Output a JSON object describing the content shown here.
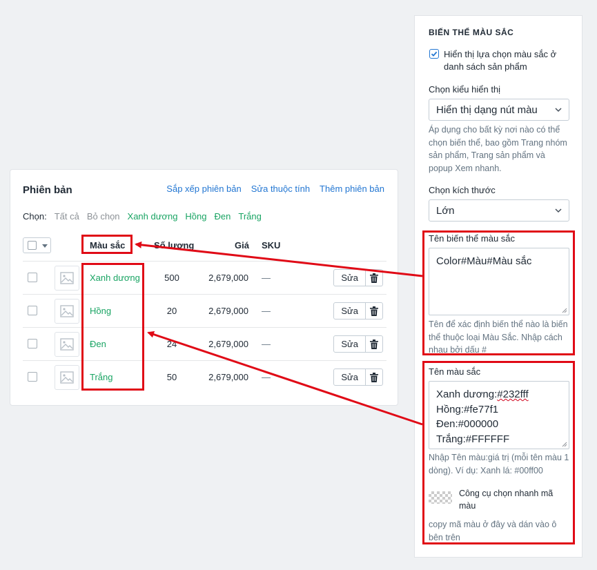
{
  "variants": {
    "title": "Phiên bản",
    "actions": [
      "Sắp xếp phiên bản",
      "Sửa thuộc tính",
      "Thêm phiên bản"
    ],
    "filter": {
      "label": "Chọn:",
      "select_all": "Tất cả",
      "deselect": "Bỏ chọn",
      "colors": [
        "Xanh dương",
        "Hồng",
        "Đen",
        "Trắng"
      ]
    },
    "columns": {
      "color": "Màu sắc",
      "qty": "Số lượng",
      "price": "Giá",
      "sku": "SKU"
    },
    "rows": [
      {
        "name": "Xanh dương",
        "qty": "500",
        "price": "2,679,000",
        "sku": "—",
        "edit": "Sửa"
      },
      {
        "name": "Hồng",
        "qty": "20",
        "price": "2,679,000",
        "sku": "—",
        "edit": "Sửa"
      },
      {
        "name": "Đen",
        "qty": "24",
        "price": "2,679,000",
        "sku": "—",
        "edit": "Sửa"
      },
      {
        "name": "Trắng",
        "qty": "50",
        "price": "2,679,000",
        "sku": "—",
        "edit": "Sửa"
      }
    ]
  },
  "panel": {
    "title": "BIẾN THỂ MÀU SẮC",
    "show_in_list_label": "Hiển thị lựa chọn màu sắc ở danh sách sản phẩm",
    "show_in_list_checked": true,
    "display_style_label": "Chọn kiểu hiển thị",
    "display_style_value": "Hiển thị dạng nút màu",
    "display_style_help": "Áp dụng cho bất kỳ nơi nào có thể chọn biến thể, bao gồm Trang nhóm sản phẩm, Trang sản phẩm và popup Xem nhanh.",
    "size_label": "Chọn kích thước",
    "size_value": "Lớn",
    "variant_name_label": "Tên biến thể màu sắc",
    "variant_name_value": "Color#Màu#Màu sắc",
    "variant_name_help": "Tên để xác định biến thể nào là biến thể thuộc loại Màu Sắc. Nhập cách nhau bởi dấu #",
    "color_names_label": "Tên màu sắc",
    "color_names_lines": [
      "Xanh dương:#232fff",
      "Hồng:#fe77f1",
      "Đen:#000000",
      "Trắng:#FFFFFF"
    ],
    "color_names_help": "Nhập Tên màu:giá trị (mỗi tên màu 1 dòng). Ví dụ: Xanh lá: #00ff00",
    "picker_label": "Công cụ chọn nhanh mã màu",
    "picker_help": "copy mã màu ở đây và dán vào ô bên trên"
  },
  "colors": {
    "link": "#2276d2",
    "green": "#19a463",
    "highlight": "#e00a16",
    "checkbox": "#2276d2"
  }
}
